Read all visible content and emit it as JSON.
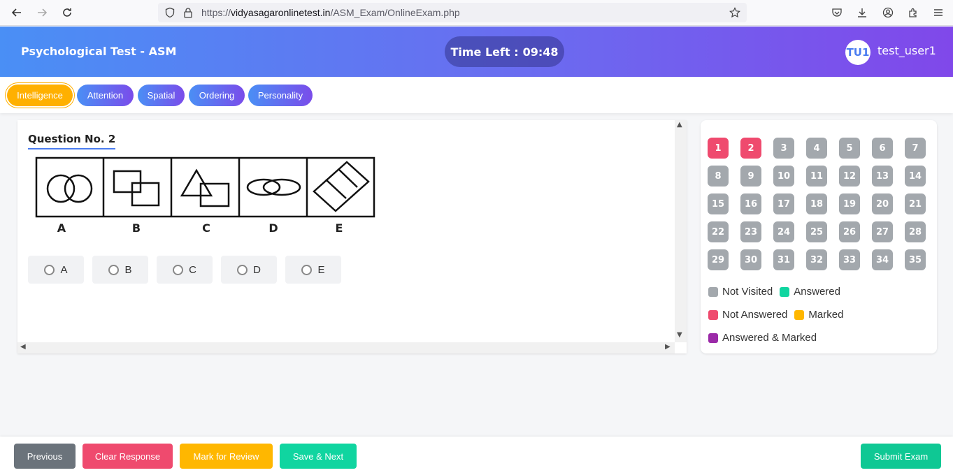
{
  "browser": {
    "url_prefix": "https://",
    "url_host": "vidyasagaronlinetest.in",
    "url_path": "/ASM_Exam/OnlineExam.php"
  },
  "header": {
    "title": "Psychological Test - ASM",
    "timer_label": "Time Left :",
    "timer_value": "09:48",
    "user_initials": "TU1",
    "user_name": "test_user1"
  },
  "sections": [
    {
      "label": "Intelligence",
      "active": true
    },
    {
      "label": "Attention",
      "active": false
    },
    {
      "label": "Spatial",
      "active": false
    },
    {
      "label": "Ordering",
      "active": false
    },
    {
      "label": "Personality",
      "active": false
    }
  ],
  "question": {
    "title": "Question No. 2",
    "figure_labels": [
      "A",
      "B",
      "C",
      "D",
      "E"
    ],
    "options": [
      "A",
      "B",
      "C",
      "D",
      "E"
    ]
  },
  "palette": {
    "questions": [
      "1",
      "2",
      "3",
      "4",
      "5",
      "6",
      "7",
      "8",
      "9",
      "10",
      "11",
      "12",
      "13",
      "14",
      "15",
      "16",
      "17",
      "18",
      "19",
      "20",
      "21",
      "22",
      "23",
      "24",
      "25",
      "26",
      "27",
      "28",
      "29",
      "30",
      "31",
      "32",
      "33",
      "34",
      "35"
    ],
    "not_answered": [
      "1",
      "2"
    ],
    "legend": {
      "not_visited": "Not Visited",
      "answered": "Answered",
      "not_answered": "Not Answered",
      "marked": "Marked",
      "answered_marked": "Answered & Marked"
    },
    "colors": {
      "not_visited": "#a3a8ad",
      "answered": "#10d5a0",
      "not_answered": "#ef4a6e",
      "marked": "#ffb700",
      "answered_marked": "#9b2aa8"
    }
  },
  "footer": {
    "previous": "Previous",
    "clear": "Clear Response",
    "mark": "Mark for Review",
    "save_next": "Save & Next",
    "submit": "Submit Exam",
    "colors": {
      "previous": "#6b737b",
      "clear": "#ef4a6e",
      "mark": "#ffb700",
      "save_next": "#10d5a0",
      "submit": "#0fc894"
    }
  }
}
